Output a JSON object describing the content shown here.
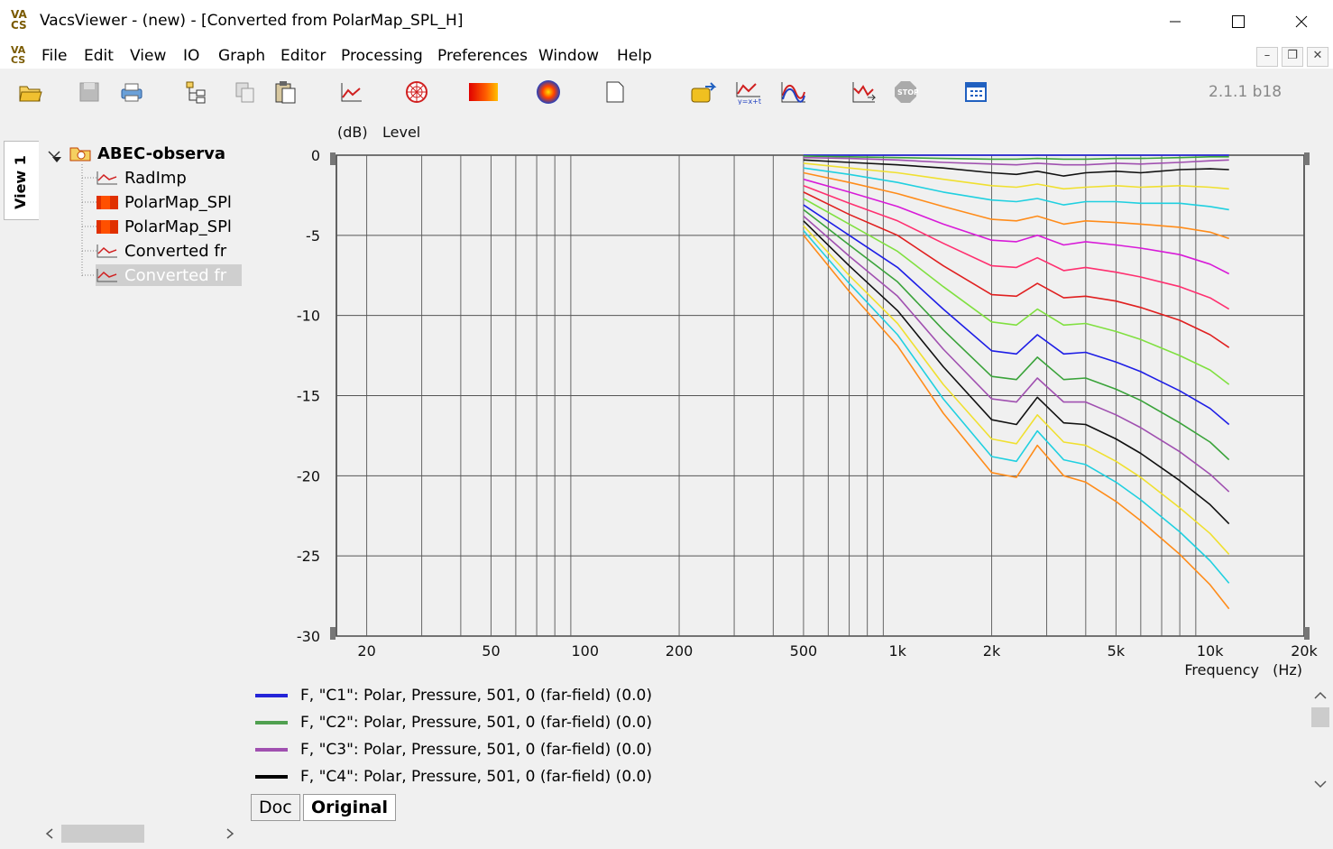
{
  "window": {
    "title": "VacsViewer - (new) - [Converted from PolarMap_SPL_H]",
    "logo_text": [
      "VA",
      "CS"
    ]
  },
  "menu": [
    "File",
    "Edit",
    "View",
    "IO",
    "Graph",
    "Editor",
    "Processing",
    "Preferences",
    "Window",
    "Help"
  ],
  "toolbar": {
    "version": "2.1.1 b18",
    "icons": [
      "open-folder-icon",
      "save-icon",
      "print-icon",
      "tree-properties-icon",
      "copy-icon",
      "paste-icon",
      "line-graph-icon",
      "polar-graph-icon",
      "color-map-icon",
      "balloon-icon",
      "new-document-icon",
      "export-icon",
      "formula-icon",
      "overlay-curves-icon",
      "calc-icon",
      "stop-icon",
      "calendar-grid-icon"
    ]
  },
  "sidebar": {
    "view_tab": "View 1",
    "root": "ABEC-observa",
    "items": [
      {
        "label": "RadImp",
        "icon": "line-graph-icon",
        "selected": false
      },
      {
        "label": "PolarMap_SPl",
        "icon": "color-map-icon",
        "selected": false
      },
      {
        "label": "PolarMap_SPl",
        "icon": "color-map-icon",
        "selected": false
      },
      {
        "label": "Converted fr",
        "icon": "line-graph-icon",
        "selected": false
      },
      {
        "label": "Converted fr",
        "icon": "line-graph-icon",
        "selected": true
      }
    ]
  },
  "chart_data": {
    "type": "line",
    "ylabel_unit": "(dB)",
    "ylabel": "Level",
    "xlabel": "Frequency",
    "xlabel_unit": "(Hz)",
    "x_scale": "log",
    "xlim": [
      16,
      20000
    ],
    "ylim": [
      -30,
      0
    ],
    "x_ticks": [
      20,
      50,
      100,
      200,
      500,
      1000,
      2000,
      5000,
      10000,
      20000
    ],
    "x_tick_labels": [
      "20",
      "50",
      "100",
      "200",
      "500",
      "1k",
      "2k",
      "5k",
      "10k",
      "20k"
    ],
    "y_ticks": [
      0,
      -5,
      -10,
      -15,
      -20,
      -25,
      -30
    ],
    "y_tick_labels": [
      "0",
      "-5",
      "-10",
      "-15",
      "-20",
      "-25",
      "-30"
    ],
    "grid": true,
    "x": [
      500,
      700,
      1000,
      1400,
      2000,
      2400,
      2800,
      3400,
      4000,
      5000,
      6000,
      8000,
      10000,
      11500
    ],
    "series": [
      {
        "color": "#1e1ee6",
        "values": [
          0,
          0,
          0,
          0,
          0,
          0,
          0,
          0,
          0,
          0,
          0,
          0,
          0,
          0
        ]
      },
      {
        "color": "#3aa33a",
        "values": [
          -0.05,
          -0.1,
          -0.15,
          -0.2,
          -0.25,
          -0.25,
          -0.2,
          -0.25,
          -0.25,
          -0.2,
          -0.2,
          -0.15,
          -0.1,
          -0.1
        ]
      },
      {
        "color": "#a050b0",
        "values": [
          -0.15,
          -0.2,
          -0.3,
          -0.45,
          -0.55,
          -0.6,
          -0.5,
          -0.6,
          -0.6,
          -0.5,
          -0.55,
          -0.45,
          -0.35,
          -0.3
        ]
      },
      {
        "color": "#111111",
        "values": [
          -0.3,
          -0.45,
          -0.6,
          -0.8,
          -1.1,
          -1.2,
          -1.0,
          -1.3,
          -1.1,
          -1.0,
          -1.1,
          -0.9,
          -0.85,
          -0.9
        ]
      },
      {
        "color": "#f0e030",
        "values": [
          -0.5,
          -0.8,
          -1.1,
          -1.5,
          -1.9,
          -2.0,
          -1.8,
          -2.1,
          -2.0,
          -1.9,
          -2.0,
          -1.9,
          -2.0,
          -2.1
        ]
      },
      {
        "color": "#20d0e0",
        "values": [
          -0.8,
          -1.2,
          -1.7,
          -2.3,
          -2.8,
          -2.9,
          -2.7,
          -3.1,
          -2.9,
          -2.9,
          -3.0,
          -3.0,
          -3.2,
          -3.4
        ]
      },
      {
        "color": "#ff8c1a",
        "values": [
          -1.1,
          -1.7,
          -2.4,
          -3.2,
          -4.0,
          -4.1,
          -3.8,
          -4.3,
          -4.1,
          -4.2,
          -4.3,
          -4.5,
          -4.8,
          -5.2
        ]
      },
      {
        "color": "#d81bd8",
        "values": [
          -1.5,
          -2.3,
          -3.2,
          -4.3,
          -5.3,
          -5.4,
          -5.0,
          -5.6,
          -5.4,
          -5.6,
          -5.8,
          -6.2,
          -6.8,
          -7.4
        ]
      },
      {
        "color": "#ff3070",
        "values": [
          -1.9,
          -3.0,
          -4.1,
          -5.5,
          -6.9,
          -7.0,
          -6.4,
          -7.2,
          -7.0,
          -7.3,
          -7.6,
          -8.2,
          -8.9,
          -9.6
        ]
      },
      {
        "color": "#e02020",
        "values": [
          -2.3,
          -3.7,
          -5.0,
          -6.9,
          -8.7,
          -8.8,
          -8.0,
          -8.9,
          -8.8,
          -9.1,
          -9.5,
          -10.3,
          -11.2,
          -12.0
        ]
      },
      {
        "color": "#80e040",
        "values": [
          -2.7,
          -4.3,
          -6.0,
          -8.2,
          -10.4,
          -10.6,
          -9.6,
          -10.6,
          -10.5,
          -11.0,
          -11.5,
          -12.5,
          -13.4,
          -14.3
        ]
      },
      {
        "color": "#1e1ee6",
        "values": [
          -3.1,
          -5.0,
          -7.0,
          -9.6,
          -12.2,
          -12.4,
          -11.2,
          -12.4,
          -12.3,
          -12.9,
          -13.5,
          -14.7,
          -15.8,
          -16.8
        ]
      },
      {
        "color": "#3aa33a",
        "values": [
          -3.4,
          -5.6,
          -7.9,
          -10.9,
          -13.8,
          -14.0,
          -12.6,
          -14.0,
          -13.9,
          -14.6,
          -15.3,
          -16.7,
          -17.9,
          -19.0
        ]
      },
      {
        "color": "#a050b0",
        "values": [
          -3.8,
          -6.3,
          -8.8,
          -12.1,
          -15.2,
          -15.4,
          -13.9,
          -15.4,
          -15.4,
          -16.2,
          -17.0,
          -18.5,
          -19.9,
          -21.0
        ]
      },
      {
        "color": "#111111",
        "values": [
          -4.1,
          -6.9,
          -9.7,
          -13.2,
          -16.5,
          -16.8,
          -15.1,
          -16.7,
          -16.8,
          -17.7,
          -18.6,
          -20.3,
          -21.8,
          -23.0
        ]
      },
      {
        "color": "#f0e030",
        "values": [
          -4.4,
          -7.5,
          -10.5,
          -14.3,
          -17.7,
          -18.0,
          -16.2,
          -17.9,
          -18.1,
          -19.1,
          -20.1,
          -22.0,
          -23.6,
          -24.9
        ]
      },
      {
        "color": "#20d0e0",
        "values": [
          -4.7,
          -8.0,
          -11.2,
          -15.2,
          -18.8,
          -19.1,
          -17.2,
          -19.0,
          -19.3,
          -20.4,
          -21.5,
          -23.5,
          -25.3,
          -26.7
        ]
      },
      {
        "color": "#ff8c1a",
        "values": [
          -5.0,
          -8.5,
          -11.9,
          -16.1,
          -19.8,
          -20.1,
          -18.1,
          -20.0,
          -20.4,
          -21.6,
          -22.8,
          -24.9,
          -26.8,
          -28.3
        ]
      }
    ]
  },
  "legend": [
    {
      "label": "F, \"C1\": Polar, Pressure, 501, 0 (far-field) (0.0)",
      "color": "#2424d8"
    },
    {
      "label": "F, \"C2\": Polar, Pressure, 501, 0 (far-field) (0.0)",
      "color": "#50a050"
    },
    {
      "label": "F, \"C3\": Polar, Pressure, 501, 0 (far-field) (0.0)",
      "color": "#a050b0"
    },
    {
      "label": "F, \"C4\": Polar, Pressure, 501, 0 (far-field) (0.0)",
      "color": "#000000"
    }
  ],
  "tabs": [
    "Doc",
    "Original"
  ],
  "active_tab": "Original"
}
